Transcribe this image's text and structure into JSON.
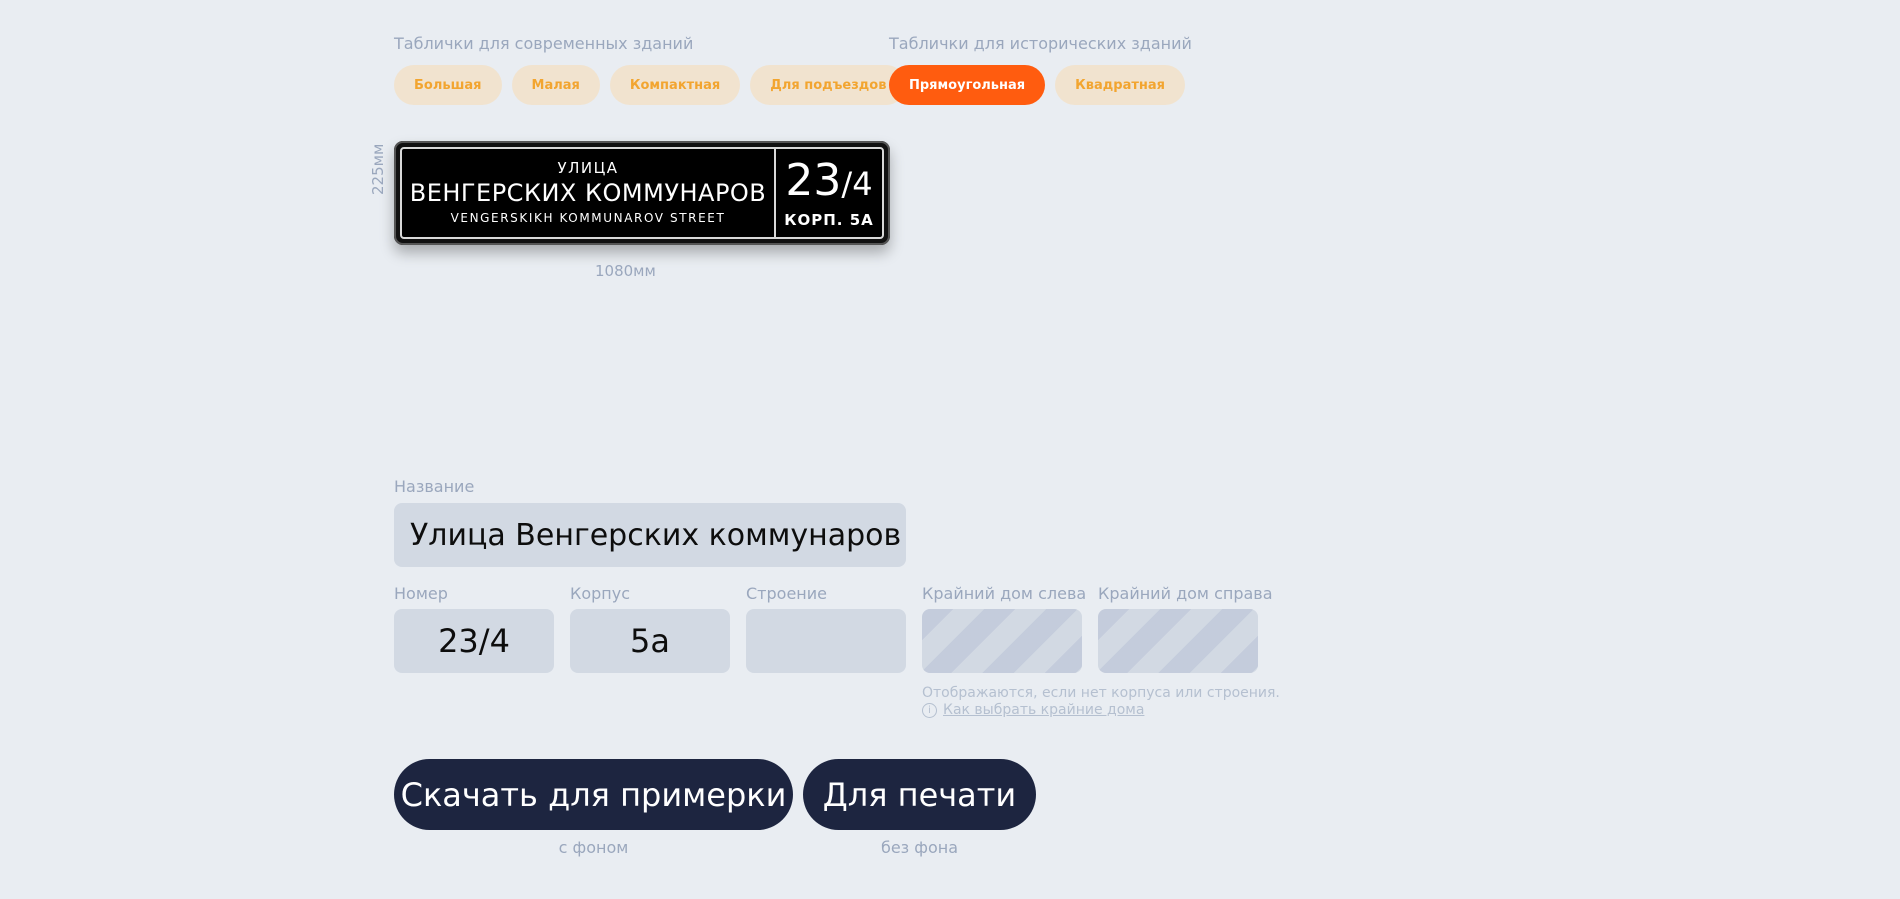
{
  "modern": {
    "label": "Таблички для современных зданий",
    "types": [
      "Большая",
      "Малая",
      "Компактная",
      "Для подъездов"
    ]
  },
  "historic": {
    "label": "Таблички для исторических зданий",
    "types": [
      "Прямоугольная",
      "Квадратная"
    ],
    "active": "Прямоугольная"
  },
  "sign": {
    "prefix": "УЛИЦА",
    "name": "ВЕНГЕРСКИХ КОММУНАРОВ",
    "name_en": "VENGERSKIKH KOMMUNAROV STREET",
    "number_main": "23",
    "number_suffix": "/4",
    "korpus": "КОРП. 5А",
    "width_label": "1080мм",
    "height_label": "225мм",
    "colors": {
      "background": "#000000",
      "text": "#ffffff",
      "frame": "#d9d9d9"
    }
  },
  "form": {
    "name_label": "Название",
    "name_value": "Улица Венгерских коммунаров",
    "number_label": "Номер",
    "number_value": "23/4",
    "korpus_label": "Корпус",
    "korpus_value": "5а",
    "building_label": "Строение",
    "building_value": "",
    "left_house_label": "Крайний дом слева",
    "right_house_label": "Крайний дом справа",
    "hint": "Отображаются, если нет корпуса или строения.",
    "hint_link": "Как выбрать крайние дома",
    "hint_icon": "info-icon"
  },
  "actions": {
    "download_label": "Скачать для примерки",
    "download_caption": "с фоном",
    "print_label": "Для печати",
    "print_caption": "без фона"
  },
  "colors": {
    "accent": "#ff5c0f",
    "pill_bg": "#f1e3cf",
    "pill_text": "#f2a530",
    "button_bg": "#1d2540",
    "page_bg": "#e9edf2"
  }
}
